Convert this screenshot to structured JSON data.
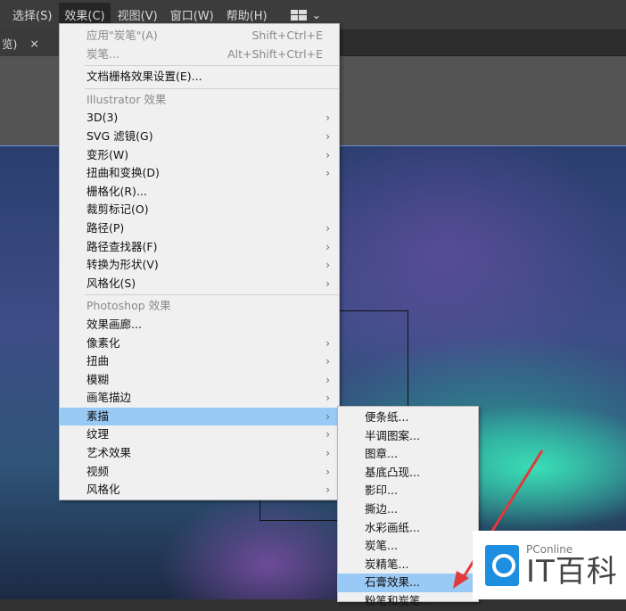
{
  "menubar": {
    "items": [
      "选择(S)",
      "效果(C)",
      "视图(V)",
      "窗口(W)",
      "帮助(H)"
    ],
    "active": "效果(C)"
  },
  "tab": {
    "label": "览)",
    "close": "×"
  },
  "effect_menu": {
    "apply_last": {
      "label": "应用\"炭笔\"(A)",
      "shortcut": "Shift+Ctrl+E"
    },
    "last_effect": {
      "label": "炭笔...",
      "shortcut": "Alt+Shift+Ctrl+E"
    },
    "doc_raster": "文档栅格效果设置(E)...",
    "illustrator_header": "Illustrator 效果",
    "illustrator_items": [
      {
        "label": "3D(3)",
        "sub": true
      },
      {
        "label": "SVG 滤镜(G)",
        "sub": true
      },
      {
        "label": "变形(W)",
        "sub": true
      },
      {
        "label": "扭曲和变换(D)",
        "sub": true
      },
      {
        "label": "栅格化(R)...",
        "sub": false
      },
      {
        "label": "裁剪标记(O)",
        "sub": false
      },
      {
        "label": "路径(P)",
        "sub": true
      },
      {
        "label": "路径查找器(F)",
        "sub": true
      },
      {
        "label": "转换为形状(V)",
        "sub": true
      },
      {
        "label": "风格化(S)",
        "sub": true
      }
    ],
    "photoshop_header": "Photoshop 效果",
    "photoshop_items": [
      {
        "label": "效果画廊...",
        "sub": false
      },
      {
        "label": "像素化",
        "sub": true
      },
      {
        "label": "扭曲",
        "sub": true
      },
      {
        "label": "模糊",
        "sub": true
      },
      {
        "label": "画笔描边",
        "sub": true
      },
      {
        "label": "素描",
        "sub": true,
        "highlight": true
      },
      {
        "label": "纹理",
        "sub": true
      },
      {
        "label": "艺术效果",
        "sub": true
      },
      {
        "label": "视频",
        "sub": true
      },
      {
        "label": "风格化",
        "sub": true
      }
    ]
  },
  "sketch_submenu": {
    "items": [
      "便条纸...",
      "半调图案...",
      "图章...",
      "基底凸现...",
      "影印...",
      "撕边...",
      "水彩画纸...",
      "炭笔...",
      "炭精笔...",
      "石膏效果...",
      "粉笔和炭笔..."
    ],
    "highlighted": "石膏效果..."
  },
  "watermark": {
    "small": "PConline",
    "big": "IT百科"
  },
  "colors": {
    "highlight": "#99c9f5",
    "arrow": "#e03a3a",
    "logo": "#1e8ee0"
  }
}
